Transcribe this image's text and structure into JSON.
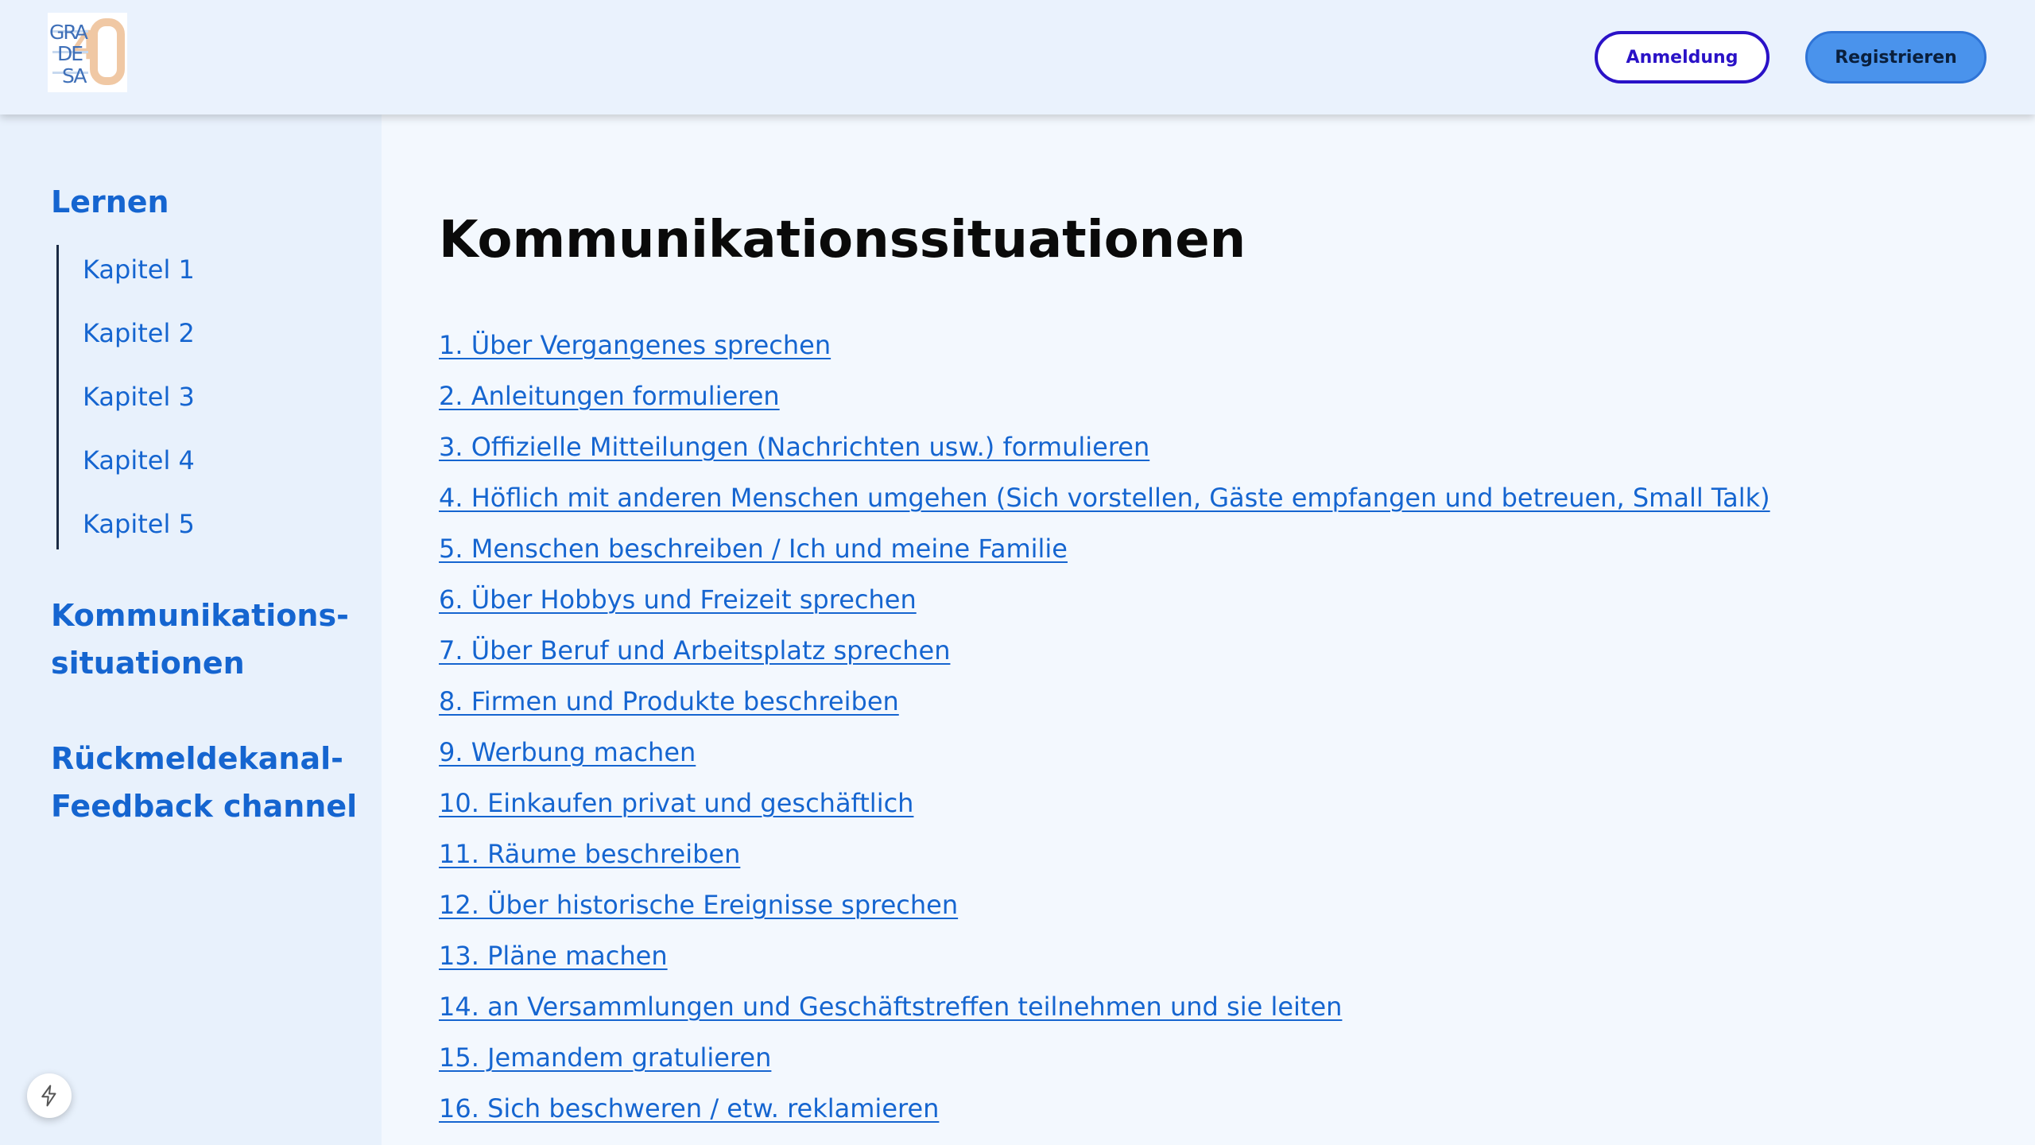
{
  "header": {
    "logo_text": "GRADESA 4.0",
    "login_label": "Anmeldung",
    "register_label": "Registrieren"
  },
  "sidebar": {
    "learn_heading": "Lernen",
    "chapters": [
      "Kapitel 1",
      "Kapitel 2",
      "Kapitel 3",
      "Kapitel 4",
      "Kapitel 5"
    ],
    "komm_line1": "Kommunikations-",
    "komm_line2": "situationen",
    "rueck_line1": "Rückmeldekanal-",
    "rueck_line2": "Feedback channel"
  },
  "main": {
    "title": "Kommunikationssituationen",
    "topics": [
      "1. Über Vergangenes sprechen",
      "2. Anleitungen formulieren",
      "3. Offizielle Mitteilungen (Nachrichten usw.) formulieren",
      "4. Höflich mit anderen Menschen umgehen (Sich vorstellen, Gäste empfangen und betreuen, Small Talk)",
      "5. Menschen beschreiben / Ich und meine Familie",
      "6. Über Hobbys und Freizeit sprechen",
      "7. Über Beruf und Arbeitsplatz sprechen",
      "8. Firmen und Produkte beschreiben",
      "9. Werbung machen",
      "10. Einkaufen privat und geschäftlich",
      "11. Räume beschreiben",
      "12. Über historische Ereignisse sprechen",
      "13. Pläne machen",
      "14. an Versammlungen und Geschäftstreffen teilnehmen und sie leiten",
      "15. Jemandem gratulieren",
      "16. Sich beschweren / etw. reklamieren"
    ]
  },
  "icons": {
    "logo": "gradesa-logo",
    "floating": "lightning-bolt-icon"
  },
  "colors": {
    "link": "#1565d0",
    "login_border": "#2a12c7",
    "register_bg": "#4a93ec"
  }
}
